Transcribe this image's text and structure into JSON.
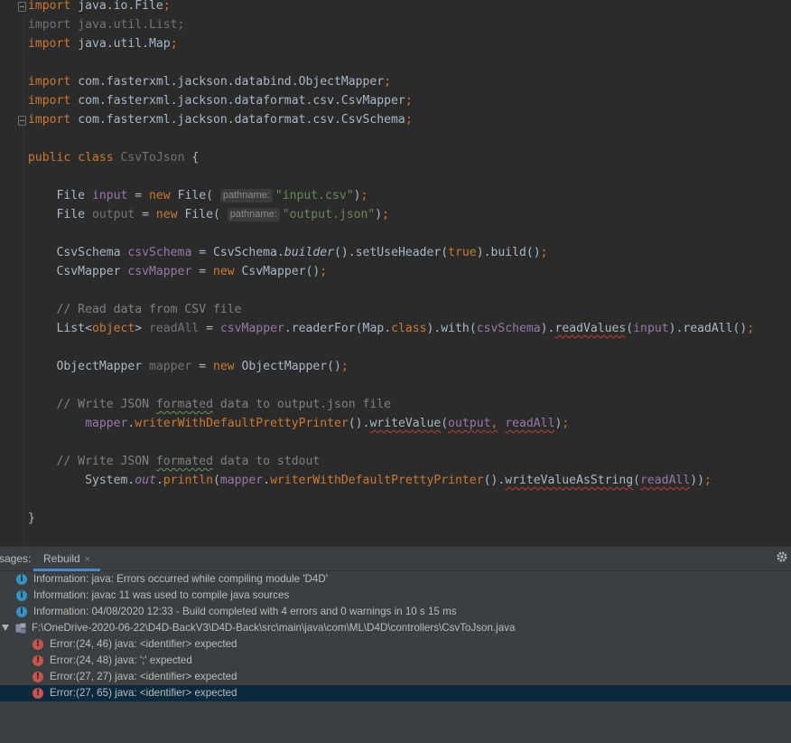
{
  "editor": {
    "lines": [
      "import java.io.File;",
      "import java.util.List;",
      "import java.util.Map;",
      "",
      "import com.fasterxml.jackson.databind.ObjectMapper;",
      "import com.fasterxml.jackson.dataformat.csv.CsvMapper;",
      "import com.fasterxml.jackson.dataformat.csv.CsvSchema;",
      "",
      "public class CsvToJson {",
      "",
      "    File input = new File( pathname: \"input.csv\");",
      "    File output = new File( pathname: \"output.json\");",
      "",
      "    CsvSchema csvSchema = CsvSchema.builder().setUseHeader(true).build();",
      "    CsvMapper csvMapper = new CsvMapper();",
      "",
      "    // Read data from CSV file",
      "    List<object> readAll = csvMapper.readerFor(Map.class).with(csvSchema).readValues(input).readAll();",
      "",
      "    ObjectMapper mapper = new ObjectMapper();",
      "",
      "    // Write JSON formated data to output.json file",
      "        mapper.writerWithDefaultPrettyPrinter().writeValue(output, readAll);",
      "",
      "    // Write JSON formated data to stdout",
      "        System.out.println(mapper.writerWithDefaultPrettyPrinter().writeValueAsString(readAll));",
      "",
      "}"
    ],
    "param_hint": "pathname:"
  },
  "messages_panel": {
    "title": "sages:",
    "tab_label": "Rebuild",
    "tab_close": "×",
    "items": [
      {
        "type": "info",
        "icon": "info-icon",
        "text": "Information: java: Errors occurred while compiling module 'D4D'"
      },
      {
        "type": "info",
        "icon": "info-icon",
        "text": "Information: javac 11 was used to compile java sources"
      },
      {
        "type": "info",
        "icon": "info-icon",
        "text": "Information: 04/08/2020 12:33 - Build completed with 4 errors and 0 warnings in 10 s 15 ms"
      },
      {
        "type": "file",
        "icon": "java-file-icon",
        "text": "F:\\OneDrive-2020-06-22\\D4D-BackV3\\D4D-Back\\src\\main\\java\\com\\ML\\D4D\\controllers\\CsvToJson.java"
      },
      {
        "type": "error",
        "icon": "error-icon",
        "text": "Error:(24, 46)  java: <identifier> expected"
      },
      {
        "type": "error",
        "icon": "error-icon",
        "text": "Error:(24, 48)  java: ';' expected"
      },
      {
        "type": "error",
        "icon": "error-icon",
        "text": "Error:(27, 27)  java: <identifier> expected"
      },
      {
        "type": "error",
        "icon": "error-icon",
        "text": "Error:(27, 65)  java: <identifier> expected",
        "selected": true
      }
    ]
  },
  "colors": {
    "editor_bg": "#2b2b2b",
    "keyword": "#cc7832",
    "string": "#6a8759",
    "field": "#9876aa",
    "comment": "#808080",
    "panel_bg": "#3c3f41",
    "selection": "#0d293e",
    "error": "#c75450",
    "info": "#3592c4"
  }
}
